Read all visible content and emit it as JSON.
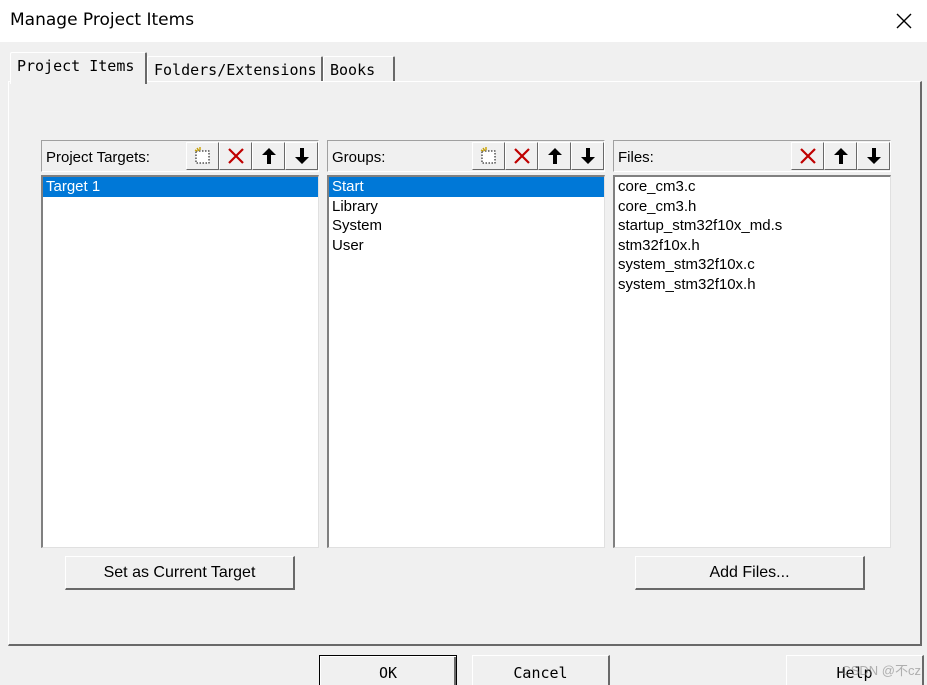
{
  "window": {
    "title": "Manage Project Items"
  },
  "tabs": [
    {
      "label": "Project Items",
      "active": true
    },
    {
      "label": "Folders/Extensions",
      "active": false
    },
    {
      "label": "Books",
      "active": false
    }
  ],
  "targets": {
    "label": "Project Targets:",
    "items": [
      {
        "text": "Target 1",
        "selected": true
      }
    ]
  },
  "groups": {
    "label": "Groups:",
    "items": [
      {
        "text": "Start",
        "selected": true
      },
      {
        "text": "Library",
        "selected": false
      },
      {
        "text": "System",
        "selected": false
      },
      {
        "text": "User",
        "selected": false
      }
    ]
  },
  "files": {
    "label": "Files:",
    "items": [
      {
        "text": "core_cm3.c",
        "selected": false
      },
      {
        "text": "core_cm3.h",
        "selected": false
      },
      {
        "text": "startup_stm32f10x_md.s",
        "selected": false
      },
      {
        "text": "stm32f10x.h",
        "selected": false
      },
      {
        "text": "system_stm32f10x.c",
        "selected": false
      },
      {
        "text": "system_stm32f10x.h",
        "selected": false
      }
    ]
  },
  "buttons": {
    "set_current": "Set as Current Target",
    "add_files": "Add Files...",
    "ok": "OK",
    "cancel": "Cancel",
    "help": "Help"
  },
  "watermark": "CSDN @不cz",
  "colors": {
    "selection": "#0078d7",
    "delete_red": "#c00000"
  }
}
